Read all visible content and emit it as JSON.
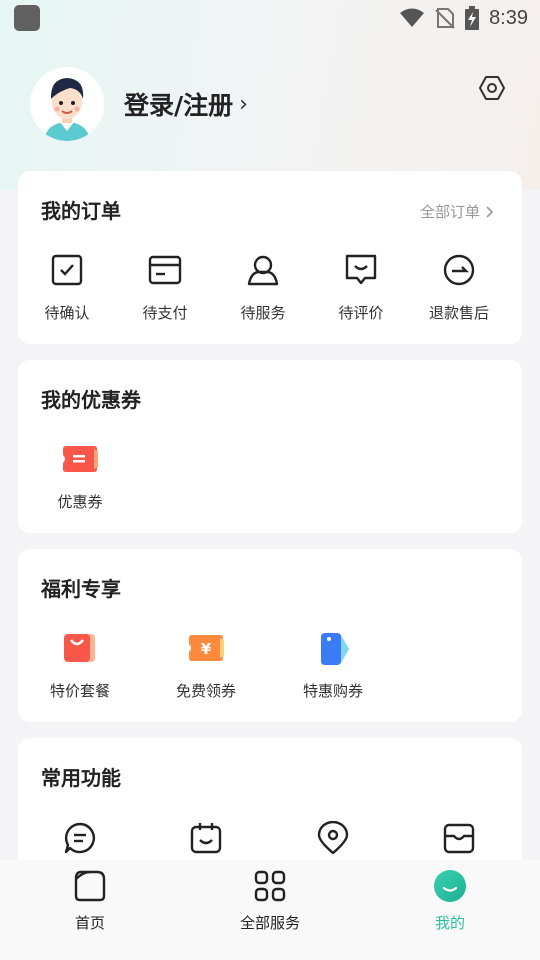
{
  "status_bar": {
    "time": "8:39",
    "icons": [
      "app-icon",
      "wifi-icon",
      "no-sim-icon",
      "battery-charging-icon"
    ]
  },
  "profile": {
    "login_label": "登录/注册",
    "chevron": "›"
  },
  "orders": {
    "title": "我的订单",
    "more_label": "全部订单",
    "items": [
      {
        "label": "待确认",
        "icon": "checkbox-icon"
      },
      {
        "label": "待支付",
        "icon": "card-icon"
      },
      {
        "label": "待服务",
        "icon": "person-icon"
      },
      {
        "label": "待评价",
        "icon": "comment-icon"
      },
      {
        "label": "退款售后",
        "icon": "refund-icon"
      }
    ]
  },
  "coupons": {
    "title": "我的优惠券",
    "items": [
      {
        "label": "优惠券",
        "icon": "coupon-icon"
      }
    ]
  },
  "welfare": {
    "title": "福利专享",
    "items": [
      {
        "label": "特价套餐",
        "icon": "shopping-bag-icon"
      },
      {
        "label": "免费领券",
        "icon": "yen-ticket-icon"
      },
      {
        "label": "特惠购券",
        "icon": "price-tag-icon"
      }
    ]
  },
  "common": {
    "title": "常用功能",
    "items": [
      {
        "icon": "message-icon"
      },
      {
        "icon": "calendar-icon"
      },
      {
        "icon": "location-icon"
      },
      {
        "icon": "inbox-icon"
      }
    ]
  },
  "tabbar": {
    "tabs": [
      {
        "label": "首页",
        "icon": "home-icon"
      },
      {
        "label": "全部服务",
        "icon": "grid-icon"
      },
      {
        "label": "我的",
        "icon": "smile-icon",
        "active": true
      }
    ]
  },
  "colors": {
    "accent": "#2bbf9f",
    "coupon_red": "#f9574a",
    "ticket_orange": "#ff8a3d",
    "tag_blue": "#3b7bf5"
  }
}
